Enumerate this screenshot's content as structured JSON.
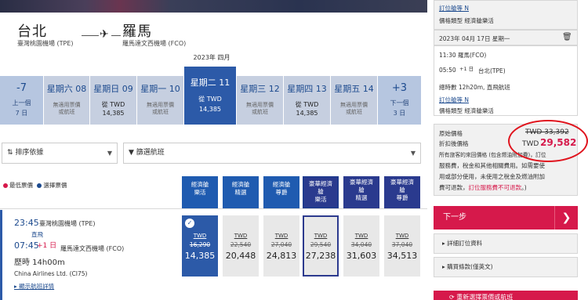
{
  "route": {
    "origin_city": "台北",
    "origin_airport": "臺灣桃園機場 (TPE)",
    "dest_city": "羅馬",
    "dest_airport": "羅馬達文西機場 (FCO)",
    "plane_icon": "airplane-icon"
  },
  "calendar": {
    "month": "2023年 四月",
    "prev": {
      "label": "-7",
      "sub1": "上一個",
      "sub2": "7 日"
    },
    "next": {
      "label": "+3",
      "sub1": "下一個",
      "sub2": "3 日"
    },
    "days": [
      {
        "label": "星期六 08",
        "line1": "無適用票價",
        "line2": "或航班",
        "has_price": false
      },
      {
        "label": "星期日 09",
        "line1": "從 TWD",
        "line2": "14,385",
        "has_price": true
      },
      {
        "label": "星期一 10",
        "line1": "無適用票價",
        "line2": "或航班",
        "has_price": false
      },
      {
        "label": "星期二 11",
        "line1": "從 TWD",
        "line2": "14,385",
        "has_price": true,
        "selected": true
      },
      {
        "label": "星期三 12",
        "line1": "無適用票價",
        "line2": "或航班",
        "has_price": false
      },
      {
        "label": "星期四 13",
        "line1": "從 TWD",
        "line2": "14,385",
        "has_price": true
      },
      {
        "label": "星期五 14",
        "line1": "無適用票價",
        "line2": "或航班",
        "has_price": false
      }
    ]
  },
  "filters": {
    "sort_label": "排序依據",
    "filter_label": "篩選航班"
  },
  "legend": {
    "lowest": "最低票價",
    "selected": "選擇票價",
    "lowest_color": "#d6194b",
    "selected_color": "#1c4a8e"
  },
  "classes": [
    {
      "line1": "經濟艙",
      "line2": "樂活"
    },
    {
      "line1": "經濟艙",
      "line2": "精選"
    },
    {
      "line1": "經濟艙",
      "line2": "尊爵"
    },
    {
      "line1": "豪華經濟",
      "line2": "艙",
      "line3": "樂活"
    },
    {
      "line1": "豪華經濟",
      "line2": "艙",
      "line3": "精選"
    },
    {
      "line1": "豪華經濟",
      "line2": "艙",
      "line3": "尊爵"
    }
  ],
  "flight": {
    "dep_time": "23:45",
    "dep_airport": "臺灣桃園機場 (TPE)",
    "nonstop": "直飛",
    "arr_time": "07:45",
    "arr_plus": "+1 日",
    "arr_airport": "羅馬達文西機場 (FCO)",
    "duration": "歷時 14h00m",
    "carrier": "China Airlines Ltd. (CI75)",
    "details_link": "顯示航班詳情",
    "fares": [
      {
        "cur": "TWD",
        "old": "16,290",
        "new": "14,385"
      },
      {
        "cur": "TWD",
        "old": "22,540",
        "new": "20,448"
      },
      {
        "cur": "TWD",
        "old": "27,040",
        "new": "24,813"
      },
      {
        "cur": "TWD",
        "old": "29,540",
        "new": "27,238"
      },
      {
        "cur": "TWD",
        "old": "34,040",
        "new": "31,603"
      },
      {
        "cur": "TWD",
        "old": "37,040",
        "new": "34,513"
      }
    ]
  },
  "sidebar": {
    "class_link_top": "訂位艙等 N",
    "fare_type_top": "價格類型 經濟艙樂活",
    "date": "2023年 04月 17日 星期一",
    "dep": "11:30 羅馬(FCO)",
    "arr_time": "05:50",
    "arr_plus": "+1 日",
    "arr_place": "台北(TPE)",
    "duration": "總時數 12h20m, 直飛航班",
    "class_link": "訂位艙等 N",
    "fare_type": "價格類型 經濟艙樂活",
    "orig_price_label": "原始價格",
    "orig_price": "TWD 33,392",
    "disc_price_label": "折扣後價格",
    "disc_cur": "TWD",
    "disc_price": "29,582",
    "note1": "所有旅客的來回價格 (包含燃油附加費)，訂位",
    "note2": "服務費，稅金和其他相關費用。如需要使",
    "note3": "用或部分使用，未使用之稅金及燃油附加",
    "note4": "費可退款，",
    "note_red": "訂位服務費不可退款",
    "note_end": "。)",
    "next_button": "下一步",
    "detail_info": "詳細訂位資料",
    "purchase_terms": "購買條款(僅英文)",
    "reselect": "重新選擇票價或航班",
    "accent_red": "#d6194b"
  }
}
